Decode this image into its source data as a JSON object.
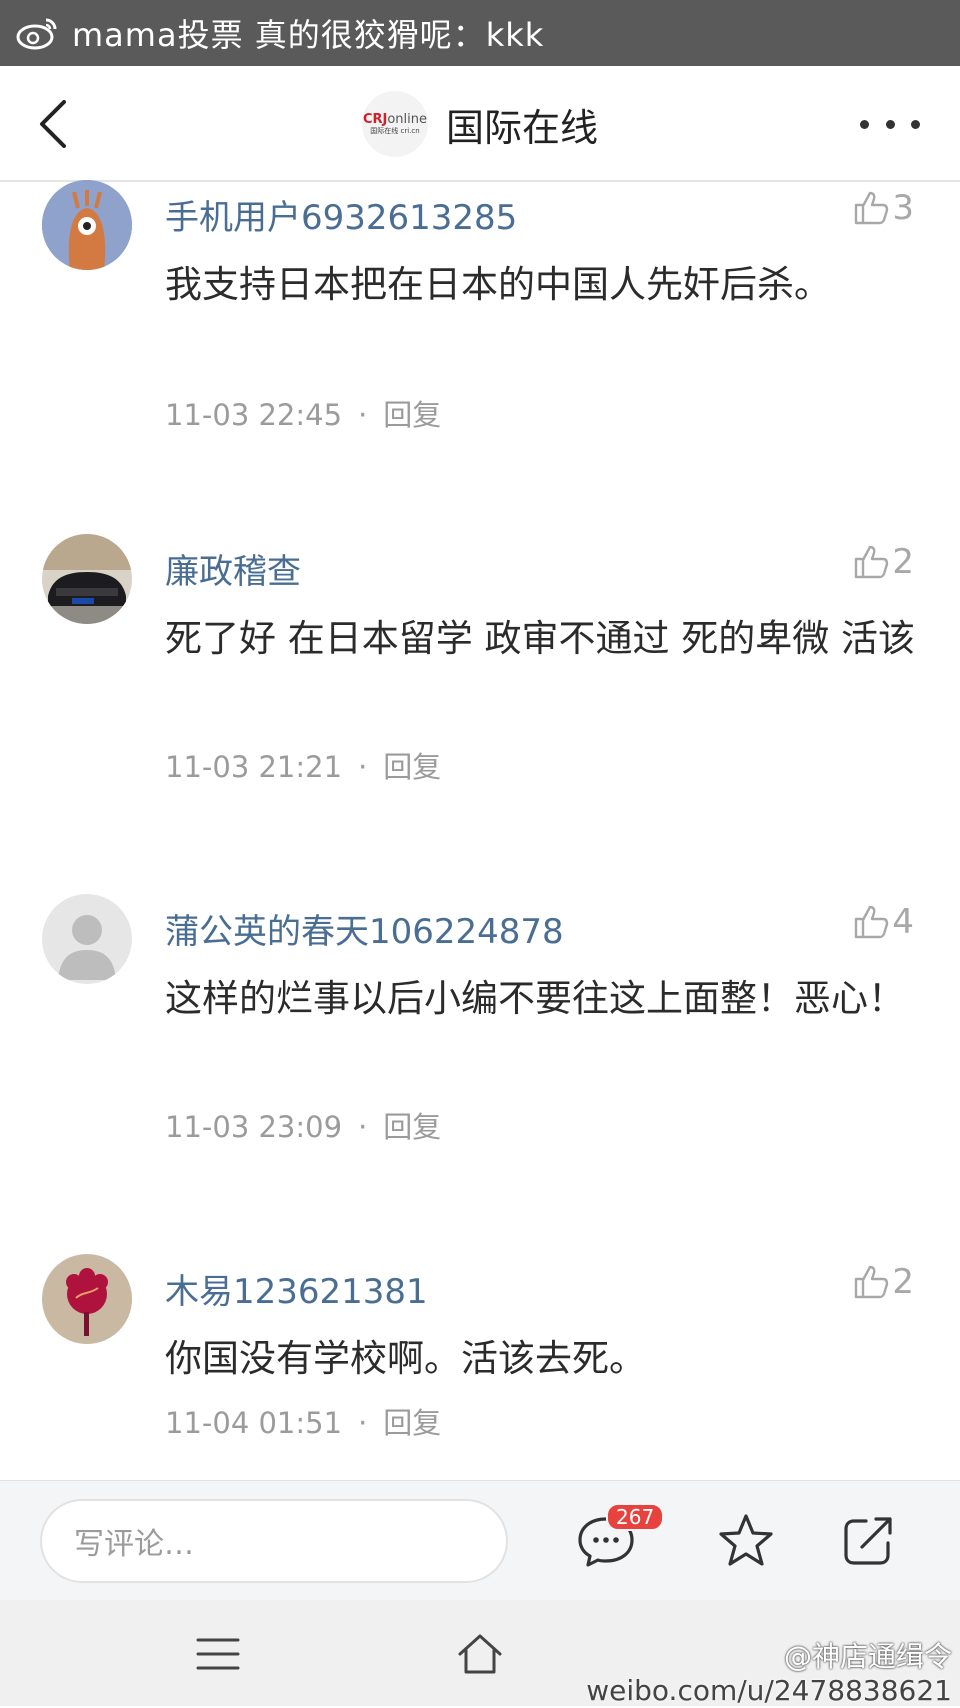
{
  "status_bar": {
    "text": "mama投票 真的很狡猾呢：kkk",
    "icon": "weibo-icon"
  },
  "header": {
    "title": "国际在线",
    "logo_text_crj": "CRJ",
    "logo_text_online": "online",
    "logo_sub": "国际在线 cri.cn",
    "back_icon": "chevron-left-icon",
    "more_icon": "more-dots-icon"
  },
  "comments": [
    {
      "username": "手机用户6932613285",
      "likes": "3",
      "text": "我支持日本把在日本的中国人先奸后杀。",
      "time": "11-03 22:45",
      "separator": "·",
      "reply": "回复"
    },
    {
      "username": "廉政稽查",
      "likes": "2",
      "text": "死了好 在日本留学 政审不通过 死的卑微 活该",
      "time": "11-03 21:21",
      "separator": "·",
      "reply": "回复"
    },
    {
      "username": "蒲公英的春天106224878",
      "likes": "4",
      "text": "这样的烂事以后小编不要往这上面整！恶心！",
      "time": "11-03 23:09",
      "separator": "·",
      "reply": "回复"
    },
    {
      "username": "木易123621381",
      "likes": "2",
      "text": "你国没有学校啊。活该去死。",
      "time": "11-04 01:51",
      "separator": "·",
      "reply": "回复"
    }
  ],
  "comment_bar": {
    "placeholder": "写评论…",
    "comment_count": "267"
  },
  "watermark": {
    "name": "@神店通缉令",
    "url": "weibo.com/u/2478838621"
  },
  "colors": {
    "username": "#4a6d93",
    "badge": "#e8423f",
    "status_bar": "#5a5a5a"
  }
}
